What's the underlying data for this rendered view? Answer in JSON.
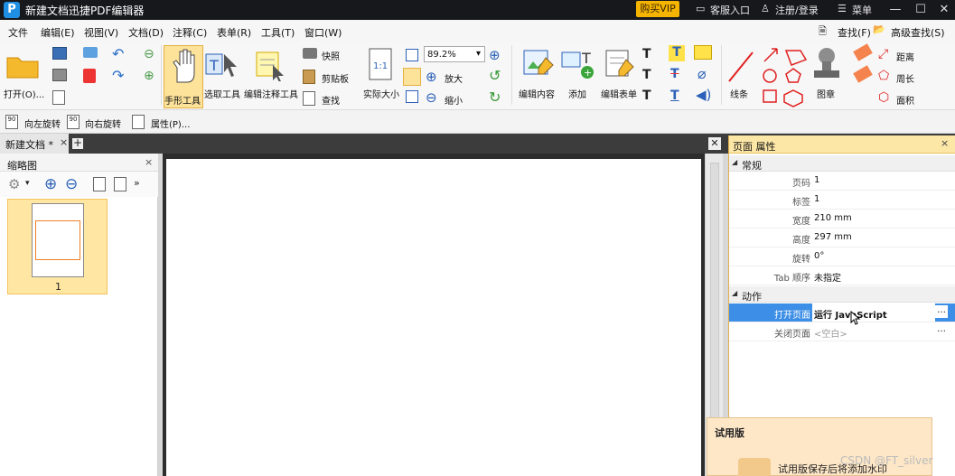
{
  "titlebar": {
    "logo_text": "P",
    "title": "新建文档迅捷PDF编辑器",
    "vip_label": "购买VIP",
    "service_label": "客服入口",
    "login_label": "注册/登录",
    "menu_label": "菜单"
  },
  "menubar": {
    "items": [
      "文件",
      "编辑(E)",
      "视图(V)",
      "文档(D)",
      "注释(C)",
      "表单(R)",
      "工具(T)",
      "窗口(W)"
    ],
    "find_label": "查找(F)",
    "adv_find_label": "高级查找(S)"
  },
  "ribbon": {
    "open_label": "打开(O)...",
    "hand_tool": "手形工具",
    "select_tool": "选取工具",
    "edit_annot_tool": "编辑注释工具",
    "snapshot": "快照",
    "clipboard": "剪贴板",
    "find": "查找",
    "actual_size": "实际大小",
    "zoom_value": "89.2%",
    "zoom_in": "放大",
    "zoom_out": "缩小",
    "edit_content": "编辑内容",
    "add": "添加",
    "edit_form": "编辑表单",
    "lines": "线条",
    "stamp": "图章",
    "distance": "距离",
    "perimeter": "周长",
    "area": "面积"
  },
  "ribbon2": {
    "rotate_left": "向左旋转",
    "rotate_right": "向右旋转",
    "properties": "属性(P)..."
  },
  "tabs": {
    "doc_tab": "新建文档 *"
  },
  "thumbnail_panel": {
    "title": "缩略图",
    "page_label": "1"
  },
  "properties_panel": {
    "title": "页面 属性",
    "general_section": "常规",
    "rows": [
      {
        "key": "页码",
        "value": "1"
      },
      {
        "key": "标签",
        "value": "1"
      },
      {
        "key": "宽度",
        "value": "210 mm"
      },
      {
        "key": "高度",
        "value": "297 mm"
      },
      {
        "key": "旋转",
        "value": "0°"
      },
      {
        "key": "Tab 顺序",
        "value": "未指定"
      }
    ],
    "action_section": "动作",
    "action_rows": [
      {
        "key": "打开页面",
        "value": "运行 JavaScript",
        "btn": "…"
      },
      {
        "key": "关闭页面",
        "value": "<空白>",
        "btn": "…"
      }
    ]
  },
  "trial": {
    "title": "试用版",
    "message": "试用版保存后将添加水印"
  },
  "watermark": "CSDN @FT_silver",
  "colors": {
    "titlebar_bg": "#17181c",
    "vip_bg": "#f5b400",
    "panel_header": "#fde7a7",
    "selection_blue": "#3c8ee6",
    "thumb_highlight": "#ffe7a3"
  }
}
